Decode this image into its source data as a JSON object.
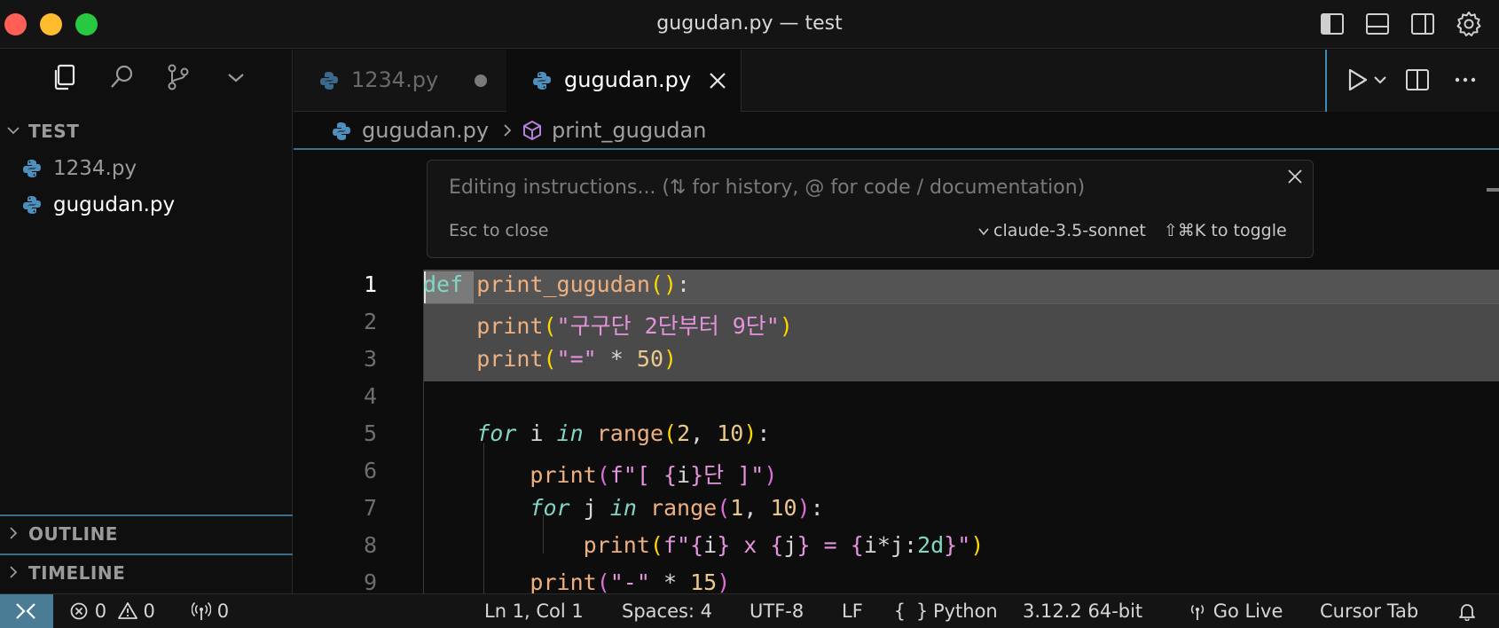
{
  "window": {
    "title": "gugudan.py — test"
  },
  "explorer": {
    "section_title": "TEST",
    "files": [
      {
        "name": "1234.py",
        "icon": "python-file-icon"
      },
      {
        "name": "gugudan.py",
        "icon": "python-file-icon",
        "selected": true
      }
    ],
    "outline_label": "OUTLINE",
    "timeline_label": "TIMELINE"
  },
  "tabs": [
    {
      "label": "1234.py",
      "active": false,
      "unsaved": true
    },
    {
      "label": "gugudan.py",
      "active": true,
      "unsaved": false
    }
  ],
  "breadcrumb": {
    "file": "gugudan.py",
    "symbol": "print_gugudan"
  },
  "prompt": {
    "placeholder": "Editing instructions... (⇅ for history, @ for code / documentation)",
    "esc_hint": "Esc to close",
    "model": "claude-3.5-sonnet",
    "toggle_hint": "⇧⌘K to toggle"
  },
  "code": {
    "line_numbers": [
      "1",
      "2",
      "3",
      "4",
      "5",
      "6",
      "7",
      "8",
      "9"
    ]
  },
  "status": {
    "errors": "0",
    "warnings": "0",
    "ports": "0",
    "position": "Ln 1, Col 1",
    "spaces": "Spaces: 4",
    "encoding": "UTF-8",
    "eol": "LF",
    "language": "Python",
    "interpreter": "3.12.2 64-bit",
    "go_live": "Go Live",
    "cursor_tab": "Cursor Tab"
  },
  "colors": {
    "accent": "#4a7c96",
    "keyword": "#83d6c5",
    "function": "#efb080",
    "string": "#e394dc",
    "number": "#ebc88d"
  }
}
